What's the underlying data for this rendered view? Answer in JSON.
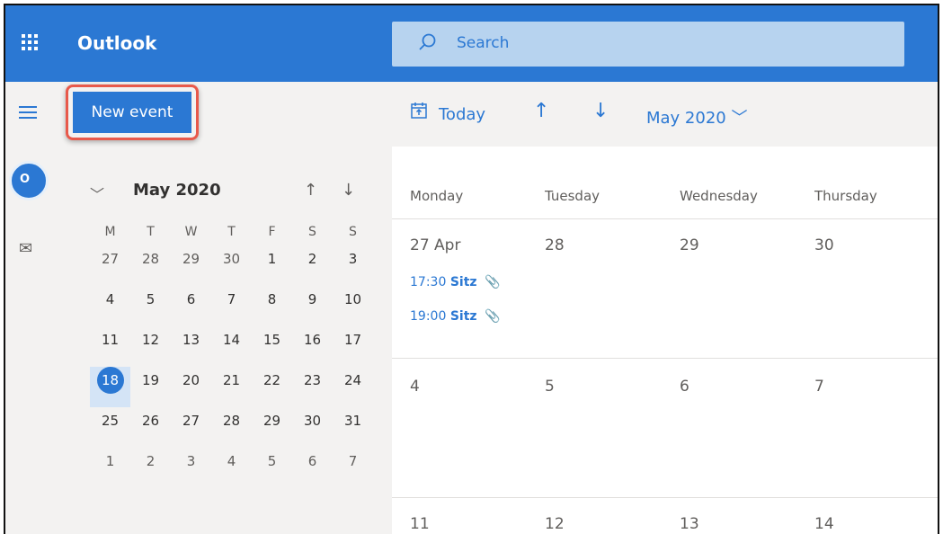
{
  "header": {
    "app_title": "Outlook",
    "search_placeholder": "Search"
  },
  "toolbar": {
    "new_event": "New event",
    "today": "Today",
    "month_label": "May 2020"
  },
  "mini_calendar": {
    "title": "May 2020",
    "weekday_headers": [
      "M",
      "T",
      "W",
      "T",
      "F",
      "S",
      "S"
    ],
    "weeks": [
      [
        "27",
        "28",
        "29",
        "30",
        "1",
        "2",
        "3"
      ],
      [
        "4",
        "5",
        "6",
        "7",
        "8",
        "9",
        "10"
      ],
      [
        "11",
        "12",
        "13",
        "14",
        "15",
        "16",
        "17"
      ],
      [
        "18",
        "19",
        "20",
        "21",
        "22",
        "23",
        "24"
      ],
      [
        "25",
        "26",
        "27",
        "28",
        "29",
        "30",
        "31"
      ],
      [
        "1",
        "2",
        "3",
        "4",
        "5",
        "6",
        "7"
      ]
    ],
    "selected": "18"
  },
  "calendar": {
    "day_headers": [
      "Monday",
      "Tuesday",
      "Wednesday",
      "Thursday"
    ],
    "week1": [
      "27 Apr",
      "28",
      "29",
      "30"
    ],
    "week2": [
      "4",
      "5",
      "6",
      "7"
    ],
    "week3": [
      "11",
      "12",
      "13",
      "14"
    ],
    "events": [
      {
        "time": "17:30",
        "title": "Sitz"
      },
      {
        "time": "19:00",
        "title": "Sitz"
      }
    ]
  },
  "colors": {
    "accent": "#2b78d3",
    "highlight": "#e8594b"
  }
}
